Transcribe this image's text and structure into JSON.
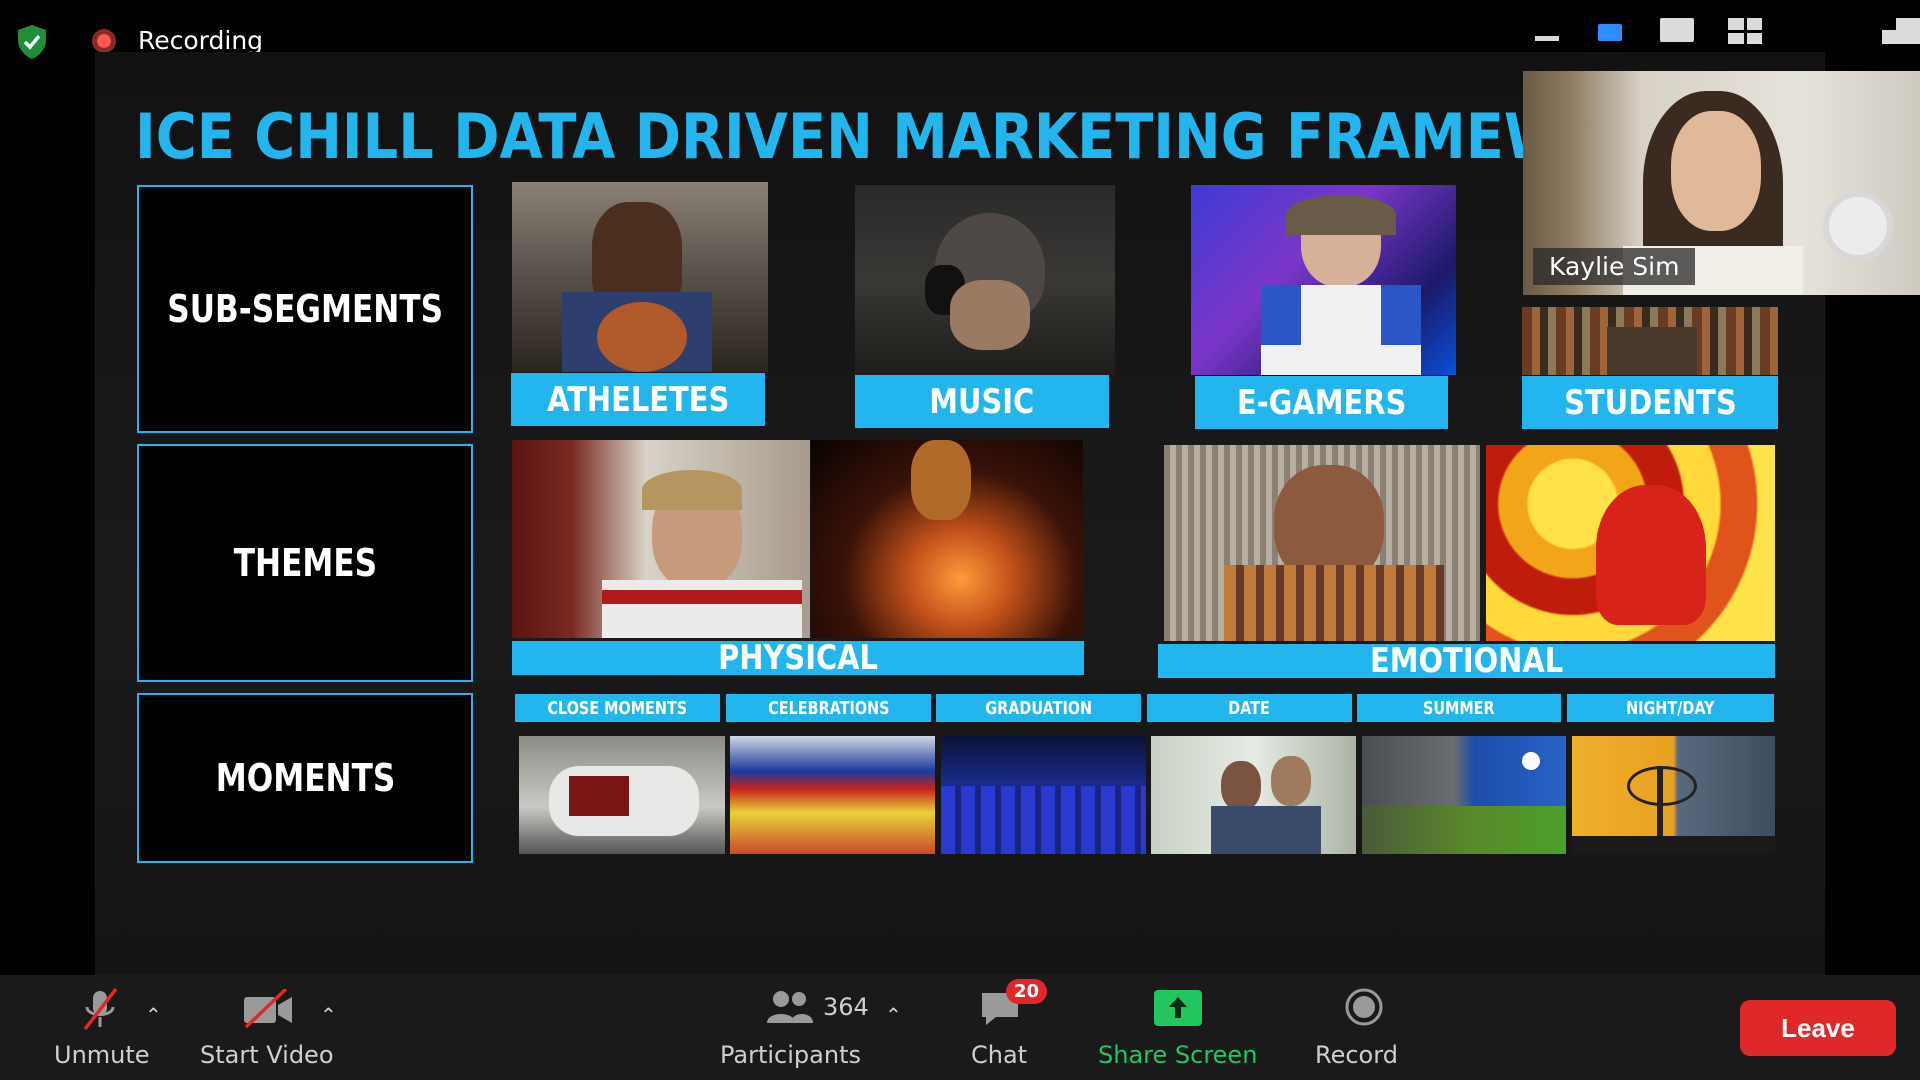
{
  "top_bar": {
    "recording_label": "Recording",
    "security_icon": "shield-check-icon",
    "recording_icon": "record-dot-icon"
  },
  "view_controls": [
    "minimize-icon",
    "speaker-view-icon",
    "single-view-icon",
    "gallery-view-icon",
    "exit-fullscreen-icon"
  ],
  "slide": {
    "title": "ICE CHILL DATA DRIVEN MARKETING FRAMEWORK",
    "rows": [
      "SUB-SEGMENTS",
      "THEMES",
      "MOMENTS"
    ],
    "sub_segments": [
      "ATHELETES",
      "MUSIC",
      "E-GAMERS",
      "STUDENTS"
    ],
    "themes": [
      "PHYSICAL",
      "EMOTIONAL"
    ],
    "moments": [
      "CLOSE MOMENTS",
      "CELEBRATIONS",
      "GRADUATION",
      "DATE",
      "SUMMER",
      "NIGHT/DAY"
    ]
  },
  "participant_video": {
    "name": "Kaylie Sim"
  },
  "toolbar": {
    "unmute_label": "Unmute",
    "start_video_label": "Start Video",
    "participants_label": "Participants",
    "participants_count": "364",
    "chat_label": "Chat",
    "chat_badge": "20",
    "share_screen_label": "Share Screen",
    "record_label": "Record",
    "leave_label": "Leave"
  },
  "colors": {
    "accent": "#22b5ee",
    "leave": "#e02828",
    "share": "#22c55e",
    "toolbar_bg": "#1a1a1a"
  }
}
